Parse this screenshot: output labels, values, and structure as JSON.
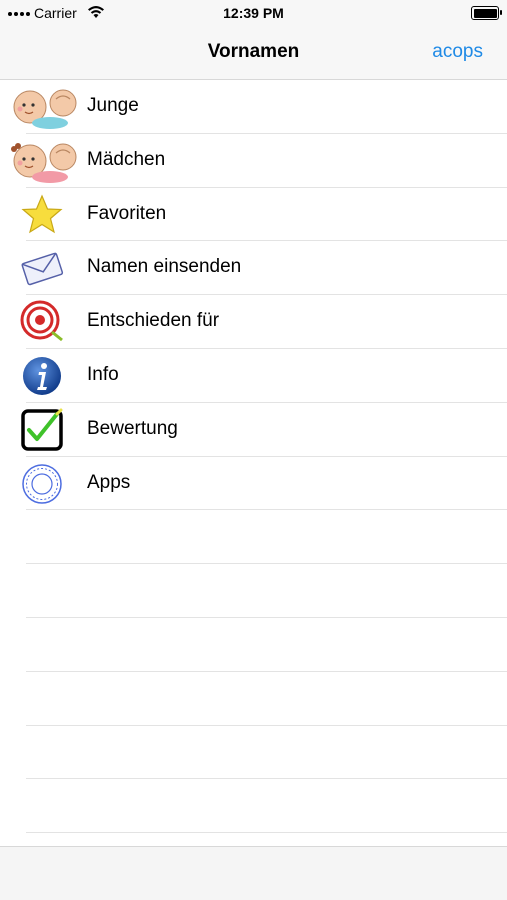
{
  "status_bar": {
    "carrier": "Carrier",
    "time": "12:39 PM"
  },
  "nav": {
    "title": "Vornamen",
    "right_button": "acops"
  },
  "menu": {
    "items": [
      {
        "label": "Junge",
        "icon": "baby-boy-icon"
      },
      {
        "label": "Mädchen",
        "icon": "baby-girl-icon"
      },
      {
        "label": "Favoriten",
        "icon": "star-icon"
      },
      {
        "label": "Namen einsenden",
        "icon": "envelope-icon"
      },
      {
        "label": "Entschieden für",
        "icon": "target-icon"
      },
      {
        "label": "Info",
        "icon": "info-icon"
      },
      {
        "label": "Bewertung",
        "icon": "checkbox-icon"
      },
      {
        "label": "Apps",
        "icon": "acops-stamp-icon"
      }
    ]
  },
  "colors": {
    "accent": "#1f8ae6",
    "separator": "#e3e3e3",
    "bar_background": "#f7f7f7"
  }
}
